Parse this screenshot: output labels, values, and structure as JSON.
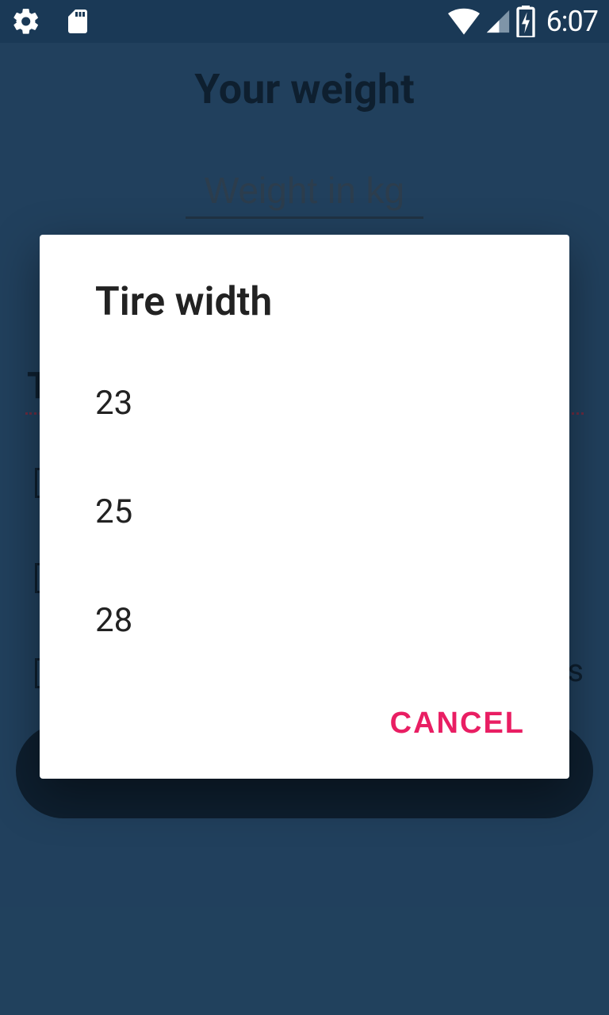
{
  "status": {
    "time": "6:07"
  },
  "page": {
    "title": "Your weight",
    "weight_placeholder": "Weight in kg",
    "bg_label_left": "T",
    "bg_text_right": "s"
  },
  "dialog": {
    "title": "Tire width",
    "options": [
      "23",
      "25",
      "28"
    ],
    "cancel_label": "CANCEL"
  }
}
